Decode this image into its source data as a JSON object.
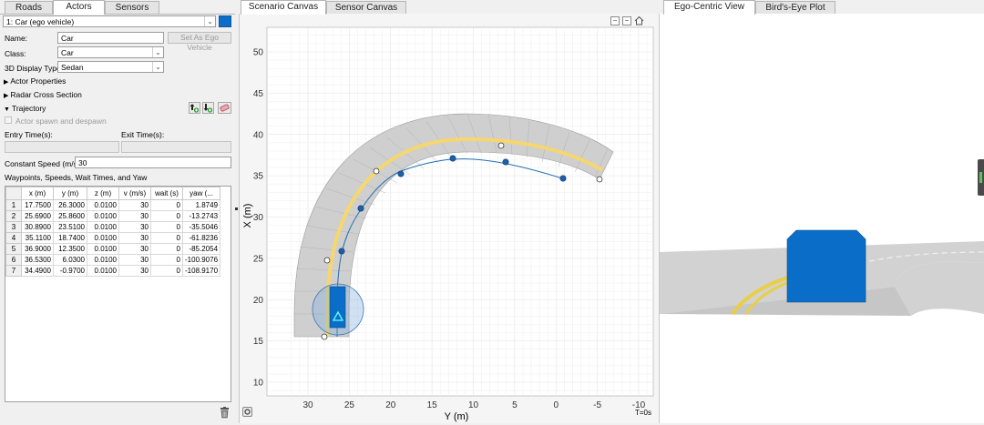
{
  "left_tabs": [
    "Roads",
    "Actors",
    "Sensors"
  ],
  "actor_selector": "1: Car (ego vehicle)",
  "name_label": "Name:",
  "name_value": "Car",
  "set_ego_button": "Set As Ego Vehicle",
  "class_label": "Class:",
  "class_value": "Car",
  "display_type_label": "3D Display Type:",
  "display_type_value": "Sedan",
  "sections": {
    "actor_properties": "Actor Properties",
    "radar_cross_section": "Radar Cross Section",
    "trajectory": "Trajectory"
  },
  "spawn_checkbox": "Actor spawn and despawn",
  "entry_time_label": "Entry Time(s):",
  "exit_time_label": "Exit Time(s):",
  "speed_label": "Constant Speed (m/s):",
  "speed_value": "30",
  "waypoints_label": "Waypoints, Speeds, Wait Times, and Yaw",
  "waypoint_table": {
    "columns": [
      "x (m)",
      "y (m)",
      "z (m)",
      "v (m/s)",
      "wait (s)",
      "yaw (..."
    ],
    "rows": [
      [
        "1",
        "17.7500",
        "26.3000",
        "0.0100",
        "30",
        "0",
        "1.8749"
      ],
      [
        "2",
        "25.6900",
        "25.8600",
        "0.0100",
        "30",
        "0",
        "-13.2743"
      ],
      [
        "3",
        "30.8900",
        "23.5100",
        "0.0100",
        "30",
        "0",
        "-35.5046"
      ],
      [
        "4",
        "35.1100",
        "18.7400",
        "0.0100",
        "30",
        "0",
        "-61.8236"
      ],
      [
        "5",
        "36.9000",
        "12.3500",
        "0.0100",
        "30",
        "0",
        "-85.2054"
      ],
      [
        "6",
        "36.5300",
        "6.0300",
        "0.0100",
        "30",
        "0",
        "-100.9076"
      ],
      [
        "7",
        "34.4900",
        "-0.9700",
        "0.0100",
        "30",
        "0",
        "-108.9170"
      ]
    ]
  },
  "canvas_tabs": [
    "Scenario Canvas",
    "Sensor Canvas"
  ],
  "view_tabs": [
    "Ego-Centric View",
    "Bird's-Eye Plot"
  ],
  "plot": {
    "xlabel": "Y (m)",
    "ylabel": "X (m)",
    "x_ticks": [
      "30",
      "25",
      "20",
      "15",
      "10",
      "5",
      "0",
      "-5",
      "-10"
    ],
    "y_ticks": [
      "50",
      "45",
      "40",
      "35",
      "30",
      "25",
      "20",
      "15",
      "10"
    ],
    "time_label": "T=0s"
  },
  "colors": {
    "road": "#c8c8c8",
    "lane_marking": "#f5d76e",
    "trajectory": "#1f6fb5",
    "vehicle": "#0a6ec8"
  },
  "icons": {
    "add_waypoint": "arrow-up-green-plus-icon",
    "remove_waypoint": "arrow-down-green-icon",
    "clear_waypoints": "eraser-icon",
    "delete": "trash-icon"
  }
}
